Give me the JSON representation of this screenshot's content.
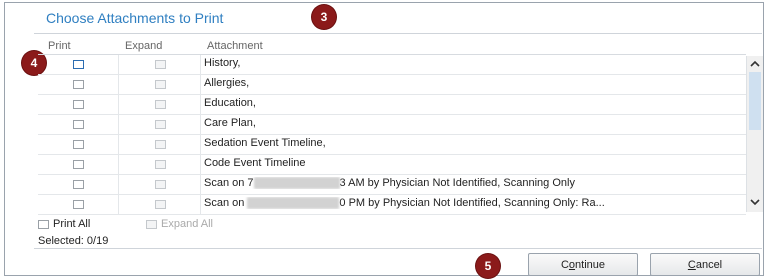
{
  "dialog": {
    "title": "Choose Attachments to Print"
  },
  "callouts": {
    "c3": "3",
    "c4": "4",
    "c5": "5"
  },
  "columns": {
    "print": "Print",
    "expand": "Expand",
    "attachment": "Attachment"
  },
  "rows": [
    {
      "attachment": "History,",
      "print_focused": true
    },
    {
      "attachment": "Allergies,",
      "print_focused": false
    },
    {
      "attachment": "Education,",
      "print_focused": false
    },
    {
      "attachment": "Care Plan,",
      "print_focused": false
    },
    {
      "attachment": "Sedation Event Timeline,",
      "print_focused": false
    },
    {
      "attachment": "Code Event Timeline",
      "print_focused": false
    },
    {
      "attachment_pre": "Scan on 7",
      "attachment_post": "3 AM by Physician Not Identified, Scanning Only",
      "print_focused": false
    },
    {
      "attachment_pre": "Scan on ",
      "attachment_post": "0 PM by Physician Not Identified, Scanning Only: Ra...",
      "print_focused": false
    }
  ],
  "controls": {
    "print_all": "Print All",
    "expand_all": "Expand All",
    "selected": "Selected: 0/19"
  },
  "buttons": {
    "continue_pre": "C",
    "continue_ul": "o",
    "continue_post": "ntinue",
    "cancel_ul": "C",
    "cancel_post": "ancel"
  },
  "colors": {
    "title": "#2f7fc1",
    "callout": "#8b1a1a"
  },
  "icons": {
    "scroll_up": "chevron-up-icon",
    "scroll_down": "chevron-down-icon"
  }
}
